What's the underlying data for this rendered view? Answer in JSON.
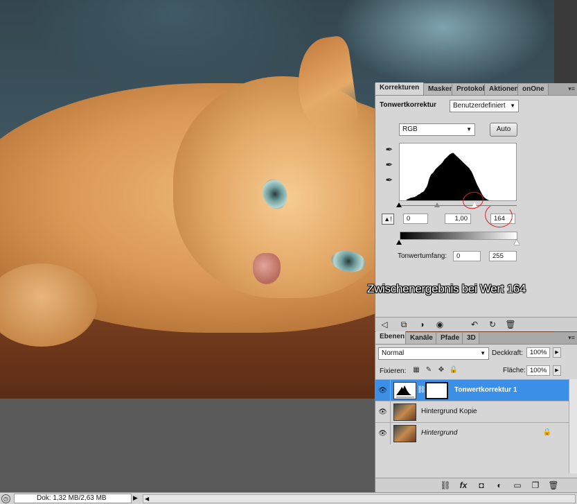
{
  "photo": {
    "alt_icon": "photo-cat"
  },
  "adjustments": {
    "tabs": [
      "Korrekturen",
      "Masken",
      "Protokoll",
      "Aktionen",
      "onOne"
    ],
    "title": "Tonwertkorrektur",
    "preset": "Benutzerdefiniert",
    "channel": "RGB",
    "auto_label": "Auto",
    "input_black": "0",
    "input_gamma": "1,00",
    "input_white": "164",
    "output_label": "Tonwertumfang:",
    "output_black": "0",
    "output_white": "255",
    "histogram": [
      2,
      2,
      3,
      4,
      5,
      5,
      6,
      6,
      7,
      8,
      10,
      11,
      12,
      14,
      15,
      16,
      18,
      22,
      25,
      30,
      38,
      44,
      48,
      50,
      52,
      55,
      58,
      60,
      62,
      64,
      66,
      68,
      70,
      73,
      76,
      78,
      80,
      82,
      84,
      86,
      87,
      88,
      88,
      86,
      84,
      82,
      80,
      78,
      76,
      74,
      72,
      70,
      68,
      66,
      64,
      62,
      60,
      57,
      54,
      50,
      45,
      40,
      35,
      30,
      26,
      22,
      18,
      14,
      10,
      7,
      5,
      3,
      2,
      1,
      0,
      0
    ],
    "input_white_fraction": 0.643
  },
  "overlay": {
    "caption": "Zwischenergebnis bei Wert 164"
  },
  "layers": {
    "tabs": [
      "Ebenen",
      "Kanäle",
      "Pfade",
      "3D"
    ],
    "blend_mode": "Normal",
    "opacity_label": "Deckkraft:",
    "opacity_value": "100%",
    "lock_label": "Fixieren:",
    "fill_label": "Fläche:",
    "fill_value": "100%",
    "rows": [
      {
        "name": "Tonwertkorrektur 1",
        "selected": true
      },
      {
        "name": "Hintergrund Kopie",
        "selected": false
      },
      {
        "name": "Hintergrund",
        "selected": false,
        "locked": true
      }
    ]
  },
  "status": {
    "doc_info": "Dok: 1,32 MB/2,63 MB"
  }
}
